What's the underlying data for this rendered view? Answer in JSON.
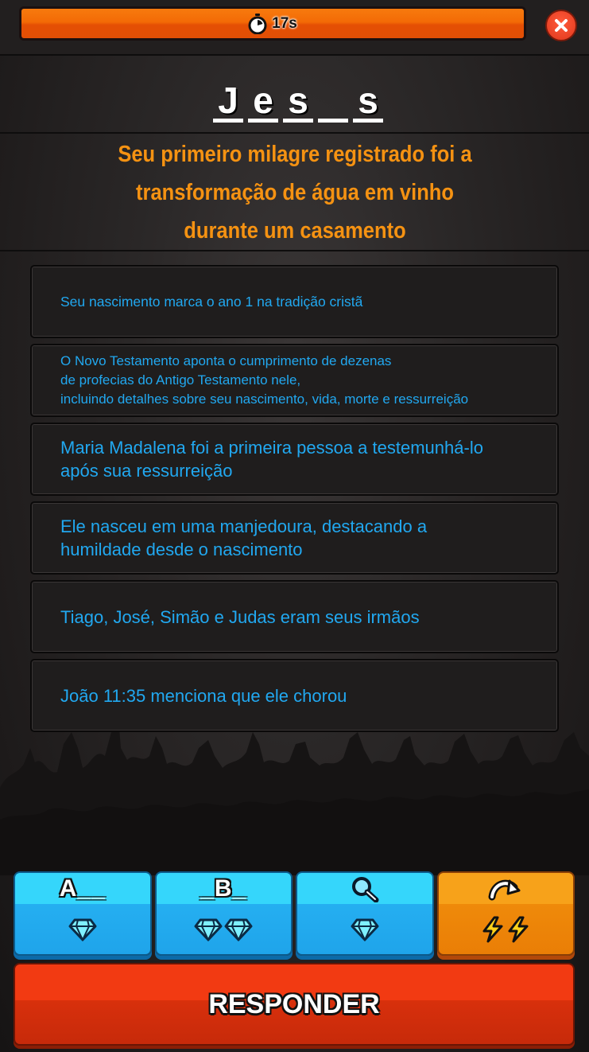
{
  "timer": {
    "label": "17s",
    "progress": 1.0
  },
  "word": {
    "slots": [
      "J",
      "e",
      "s",
      "",
      "s"
    ]
  },
  "clue": {
    "line1": "Seu primeiro milagre registrado foi a",
    "line2": "transformação de água em vinho",
    "line3": "durante um casamento"
  },
  "hints": [
    {
      "lines": [
        "Seu nascimento marca o ano 1 na tradição cristã"
      ]
    },
    {
      "lines": [
        "O Novo Testamento aponta o cumprimento de dezenas",
        "de profecias do Antigo Testamento nele,",
        "incluindo detalhes sobre seu nascimento, vida, morte e ressurreição"
      ]
    },
    {
      "lines": [
        "Maria Madalena foi a primeira pessoa a testemunhá-lo",
        "após sua ressurreição"
      ]
    },
    {
      "lines": [
        "Ele nasceu em uma manjedoura, destacando a",
        "humildade desde o nascimento"
      ]
    },
    {
      "lines": [
        "Tiago, José, Simão e Judas eram seus irmãos"
      ]
    },
    {
      "lines": [
        "João 11:35 menciona que ele chorou"
      ]
    }
  ],
  "powerups": [
    {
      "label": "A__",
      "cost_icon": "diamond-icon",
      "cost_count": 1
    },
    {
      "label": "_B_",
      "cost_icon": "diamond-icon",
      "cost_count": 2
    },
    {
      "icon": "magnifier-icon",
      "cost_icon": "diamond-icon",
      "cost_count": 1
    },
    {
      "icon": "skip-arrow-icon",
      "cost_icon": "lightning-icon",
      "cost_count": 2
    }
  ],
  "respond": {
    "label": "RESPONDER"
  },
  "colors": {
    "clue": "#f59212",
    "hint_text": "#21a8f0",
    "timer": "#f36a06",
    "respond": "#f23a12",
    "powerup_blue": "#25aff1",
    "powerup_orange": "#ef8a0a"
  }
}
